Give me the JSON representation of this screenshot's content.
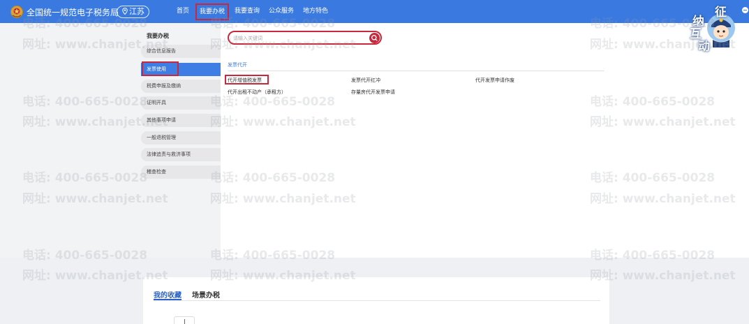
{
  "header": {
    "site_title": "全国统一规范电子税务局",
    "province": "江苏",
    "nav": [
      "首页",
      "我要办税",
      "我要查询",
      "公众服务",
      "地方特色"
    ]
  },
  "mascot": {
    "chars": [
      "征",
      "纳",
      "互",
      "动"
    ]
  },
  "sidebar": {
    "title": "我要办税",
    "items": [
      "综合信息报告",
      "发票使用",
      "税费申报及缴纳",
      "证明开具",
      "其他事项申请",
      "一般退税管理",
      "法律追责与救济事项",
      "稽查检查"
    ],
    "active_index": 1
  },
  "search": {
    "placeholder": "请输入关键词"
  },
  "section": {
    "title": "发票代开",
    "services": [
      "代开增值税发票",
      "发票代开红冲",
      "代开发票申请作废",
      "代开出租不动产（承租方）",
      "存量房代开发票申请"
    ]
  },
  "card": {
    "tabs": [
      "我的收藏",
      "场景办税"
    ]
  },
  "watermark": {
    "phone": "电话: 400-665-0028",
    "site": "网址: www.chanjet.net"
  },
  "colors": {
    "primary": "#3a7ae0",
    "highlight": "#c8283c",
    "menu_active": "#3d7de4"
  }
}
